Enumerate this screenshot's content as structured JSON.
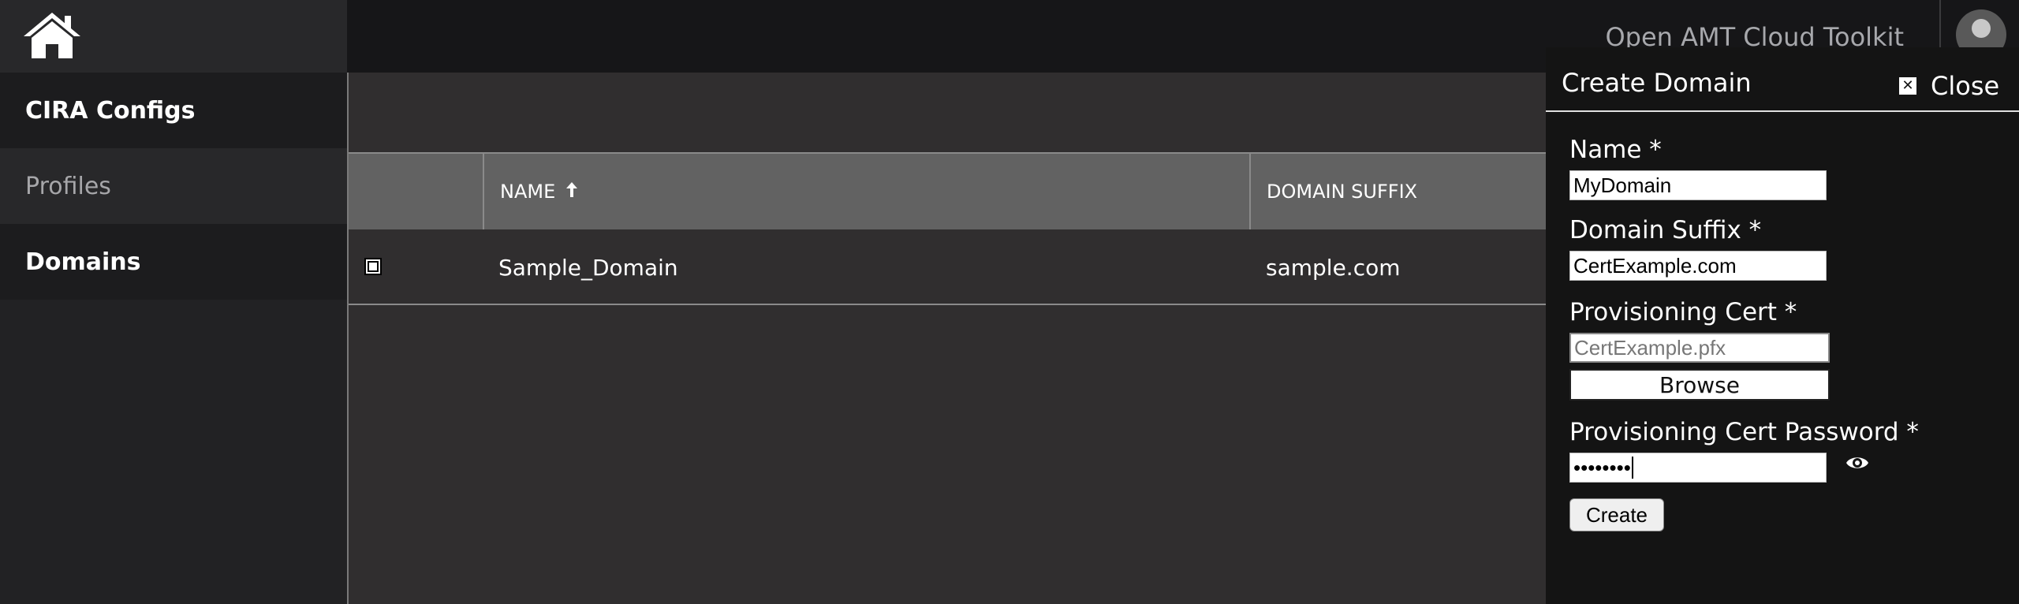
{
  "app": {
    "brand": "Open AMT Cloud Toolkit"
  },
  "sidebar": {
    "items": [
      {
        "label": "CIRA Configs"
      },
      {
        "label": "Profiles"
      },
      {
        "label": "Domains"
      }
    ]
  },
  "table": {
    "columns": [
      {
        "label": "NAME",
        "sort": "ascending"
      },
      {
        "label": "DOMAIN SUFFIX"
      }
    ],
    "rows": [
      {
        "name": "Sample_Domain",
        "suffix": "sample.com"
      }
    ]
  },
  "drawer": {
    "title": "Create Domain",
    "close_label": "Close",
    "fields": {
      "name": {
        "label": "Name *",
        "value": "MyDomain"
      },
      "suffix": {
        "label": "Domain Suffix *",
        "value": "CertExample.com"
      },
      "cert": {
        "label": "Provisioning Cert *",
        "value": "CertExample.pfx",
        "browse_label": "Browse"
      },
      "password": {
        "label": "Provisioning Cert Password *",
        "value": "••••••••"
      }
    },
    "create_label": "Create"
  }
}
